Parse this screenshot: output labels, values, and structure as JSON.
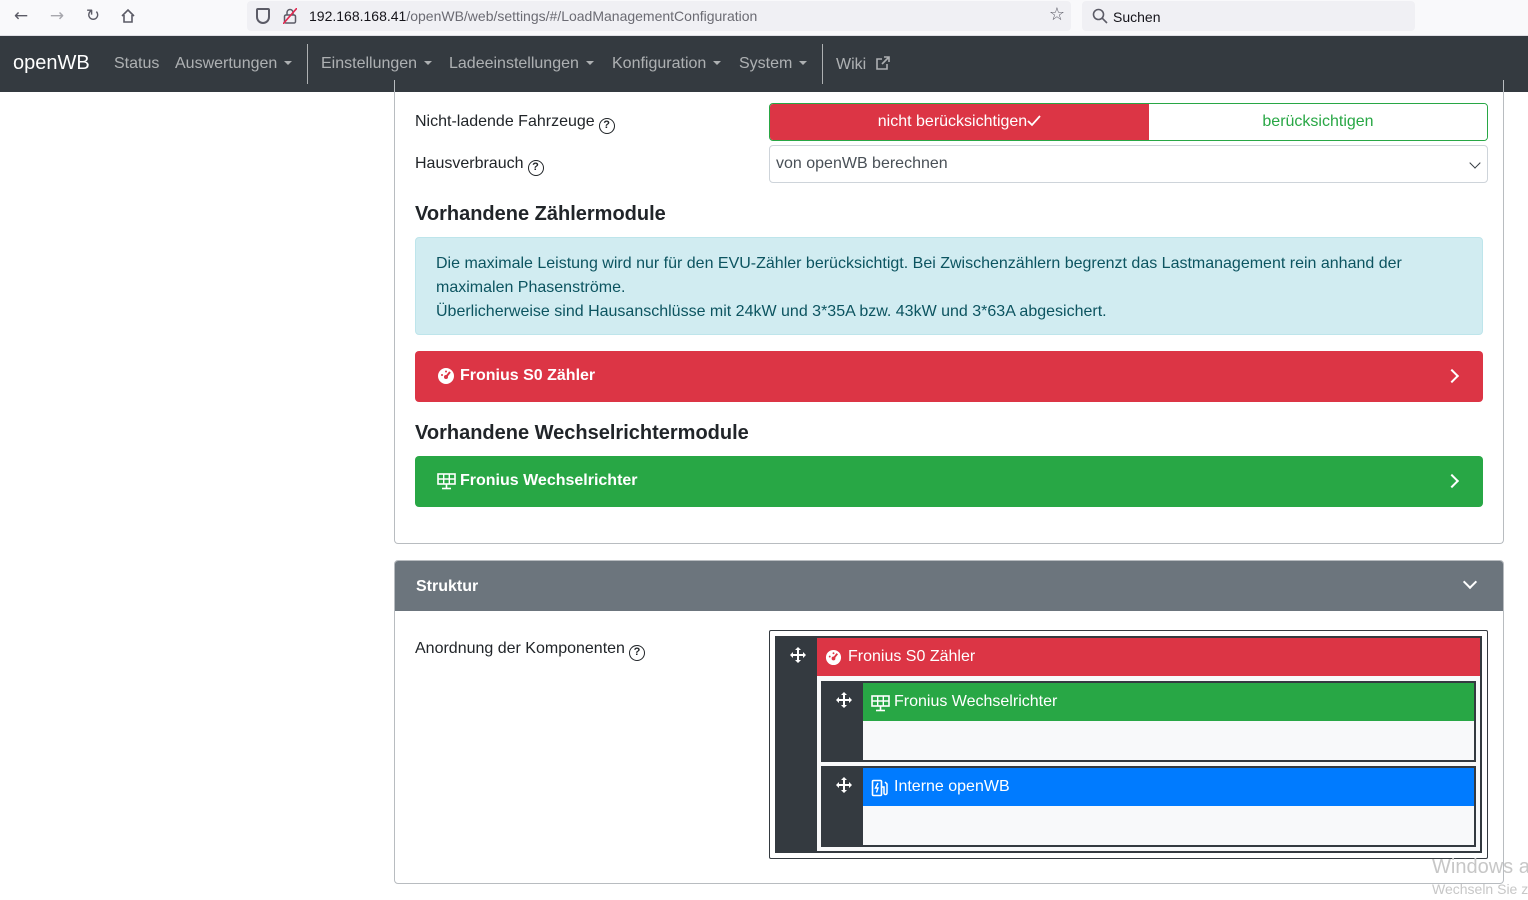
{
  "browser": {
    "url_host": "192.168.168.41",
    "url_path": "/openWB/web/settings/#/LoadManagementConfiguration",
    "search_placeholder": "Suchen"
  },
  "navbar": {
    "brand": "openWB",
    "items": [
      {
        "label": "Status"
      },
      {
        "label": "Auswertungen"
      },
      {
        "label": "Einstellungen"
      },
      {
        "label": "Ladeeinstellungen"
      },
      {
        "label": "Konfiguration"
      },
      {
        "label": "System"
      },
      {
        "label": "Wiki"
      }
    ]
  },
  "settings": {
    "non_charging_label": "Nicht-ladende Fahrzeuge",
    "non_charging_options": [
      "nicht berücksichtigen",
      "berücksichtigen"
    ],
    "non_charging_selected": "nicht berücksichtigen",
    "house_consumption_label": "Hausverbrauch",
    "house_consumption_value": "von openWB berechnen"
  },
  "meters": {
    "title": "Vorhandene Zählermodule",
    "info_line1": "Die maximale Leistung wird nur für den EVU-Zähler berücksichtigt. Bei Zwischenzählern begrenzt das Lastmanagement rein anhand der",
    "info_line2": "maximalen Phasenströme.",
    "info_line3": "Überlicherweise sind Hausanschlüsse mit 24kW und 3*35A bzw. 43kW und 3*63A abgesichert.",
    "module_label": "Fronius S0 Zähler"
  },
  "inverters": {
    "title": "Vorhandene Wechselrichtermodule",
    "module_label": "Fronius Wechselrichter"
  },
  "structure": {
    "title": "Struktur",
    "arrangement_label": "Anordnung der Komponenten",
    "nodes": [
      {
        "label": "Fronius S0 Zähler"
      },
      {
        "label": "Fronius Wechselrichter"
      },
      {
        "label": "Interne openWB"
      }
    ]
  },
  "watermark": {
    "line1": "Windows a",
    "line2": "Wechseln Sie z"
  },
  "colors": {
    "danger": "#dc3545",
    "success": "#28a745",
    "primary": "#007bff",
    "dark": "#343a40",
    "secondary": "#6c757d",
    "info_bg": "#d1ecf1"
  }
}
